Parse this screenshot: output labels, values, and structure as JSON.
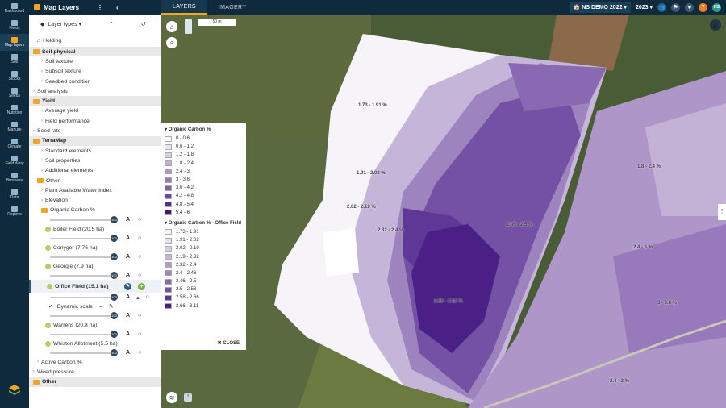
{
  "rail": [
    {
      "label": "Dashboard"
    },
    {
      "label": "Fields"
    },
    {
      "label": "Map layers"
    },
    {
      "label": "Soil"
    },
    {
      "label": "Stocks"
    },
    {
      "label": "Seeds"
    },
    {
      "label": "Nutrition"
    },
    {
      "label": "Manure"
    },
    {
      "label": "Climate"
    },
    {
      "label": "Field diary"
    },
    {
      "label": "Business"
    },
    {
      "label": "Data"
    },
    {
      "label": "Reports"
    }
  ],
  "topbar": {
    "title": "Map Layers",
    "tabs": [
      "LAYERS",
      "IMAGERY"
    ],
    "farm": "NS DEMO 2022",
    "year": "2023",
    "user": "NS"
  },
  "sidebar": {
    "dropdown": "Layer types",
    "holding": "Holding",
    "rows": [
      "Soil physical",
      "Soil texture",
      "Subsoil texture",
      "Seedbed condition",
      "Soil analysis",
      "Yield",
      "Yield",
      "Average yield",
      "Field performance",
      "Seed rate",
      "TerraMap",
      "Standard elements",
      "Soil properties",
      "Additional elements",
      "Other",
      "Plant Available Water Index",
      "Elevation",
      "Organic Carbon %"
    ],
    "fields": [
      {
        "name": "Boiler Field (20.5 ha)"
      },
      {
        "name": "Conyger (7.76 ha)"
      },
      {
        "name": "Georgie (7.9 ha)"
      },
      {
        "name": "Office Field (15.1 ha)"
      },
      {
        "name": "Warrens (20.8 ha)"
      },
      {
        "name": "Whiston Allotment (5.5 ha)"
      }
    ],
    "dynamic": "Dynamic scale",
    "slider_val": "100",
    "bottom": [
      "Active Carbon %",
      "Weed pressure",
      "Other"
    ]
  },
  "legend": {
    "title1": "Organic Carbon %",
    "items1": [
      "0 - 0.6",
      "0.6 - 1.2",
      "1.2 - 1.8",
      "1.8 - 2.4",
      "2.4 - 3",
      "3 - 3.6",
      "3.6 - 4.2",
      "4.2 - 4.8",
      "4.8 - 5.4",
      "5.4 - 6"
    ],
    "title2": "Organic Carbon % - Office Field",
    "items2": [
      "1.73 - 1.91",
      "1.91 - 2.02",
      "2.02 - 2.19",
      "2.19 - 2.32",
      "2.32 - 2.4",
      "2.4 - 2.46",
      "2.46 - 2.5",
      "2.5 - 2.58",
      "2.58 - 2.66",
      "2.66 - 3.11"
    ],
    "close": "CLOSE"
  },
  "map": {
    "scale": "50 m",
    "labels": [
      "1.73 - 1.91 %",
      "1.91 - 2.02 %",
      "2.02 - 2.19 %",
      "2.32 - 2.4 %",
      "2.46 - 2.5 %",
      "2.66 - 3.11 %",
      "1.8 - 2.4 %",
      "2.4 - 3 %",
      "3 - 3.6 %",
      "2.4 - 3 %"
    ]
  },
  "colors": {
    "c1": [
      "#ffffff",
      "#ebe6f1",
      "#d8cee4",
      "#c3b2d6",
      "#ae96c9",
      "#9879bb",
      "#835dad",
      "#6e42a0",
      "#5a2a91",
      "#431774"
    ],
    "c2": [
      "#f6f3f9",
      "#e7e1ef",
      "#d6cce5",
      "#c4b5d9",
      "#b19dcc",
      "#9d84bf",
      "#896ab2",
      "#7451a4",
      "#5f3897",
      "#4a1f86"
    ]
  }
}
